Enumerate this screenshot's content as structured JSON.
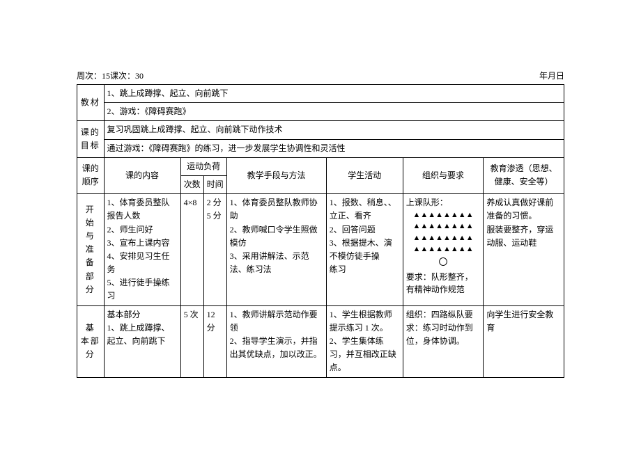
{
  "header": {
    "left": "周次：15课次：30",
    "right": "年月日"
  },
  "rows": {
    "jiaocai_label": "教材",
    "jiaocai_line1": "1、跳上成蹲撑、起立、向前跳下",
    "jiaocai_line2": "2、游戏：《障碍赛跑》",
    "mubiao_label": "课的目标",
    "mubiao_line1": "复习巩固跳上成蹲撑、起立、向前跳下动作技术",
    "mubiao_line2": "通过游戏：《障碍赛跑》的练习，进一步发展学生协调性和灵活性"
  },
  "cols": {
    "order": "课的顺序",
    "content": "课的内容",
    "load": "运动负荷",
    "load_count": "次数",
    "load_time": "时间",
    "method": "教学手段与方法",
    "student": "学生活动",
    "org": "组织与要求",
    "edu": "教育渗透（思想、健康、安全等）"
  },
  "part1": {
    "label": "开 始 与 准 备 部 分",
    "content": "1、体育委员整队报告人数\n2、师生问好\n3、宣布上课内容\n4、安排见习生任务\n5、进行徒手操练习",
    "count": "4×8",
    "time": "2 分\n5 分",
    "method": "1、体育委员整队教师协助\n2、教师喊口令学生照做模仿\n3、采用讲解法、示范法、练习法",
    "student": "1、报数、稍息、、立正、看齐\n2、回答问题\n3、根据提木、演不模仿徒手操\n练习",
    "org_intro": "上课队形：",
    "org_req": "要求：队形整齐，有精神动作规范",
    "triangles": "▲▲▲▲▲▲▲▲",
    "circle": "〇",
    "edu": "养成认真做好课前准备的习惯。\n服装要整齐，穿运动服、运动鞋"
  },
  "part2": {
    "label": "基 本部分",
    "content": "基本部分\n1、跳上成蹲撑、起立、向前跳下",
    "count": "5 次",
    "time": "12 分",
    "method": "1、教师讲解示范动作要领\n2、指导学生演示，并指出其优缺点，加以改正。",
    "student": "1、学生根据教师提示练习 1 次。\n2、学生集体练习，并互相改正缺点。",
    "org": "组织：四路纵队要求：练习时动作到位，身体协调。",
    "edu": "向学生进行安全教育"
  }
}
